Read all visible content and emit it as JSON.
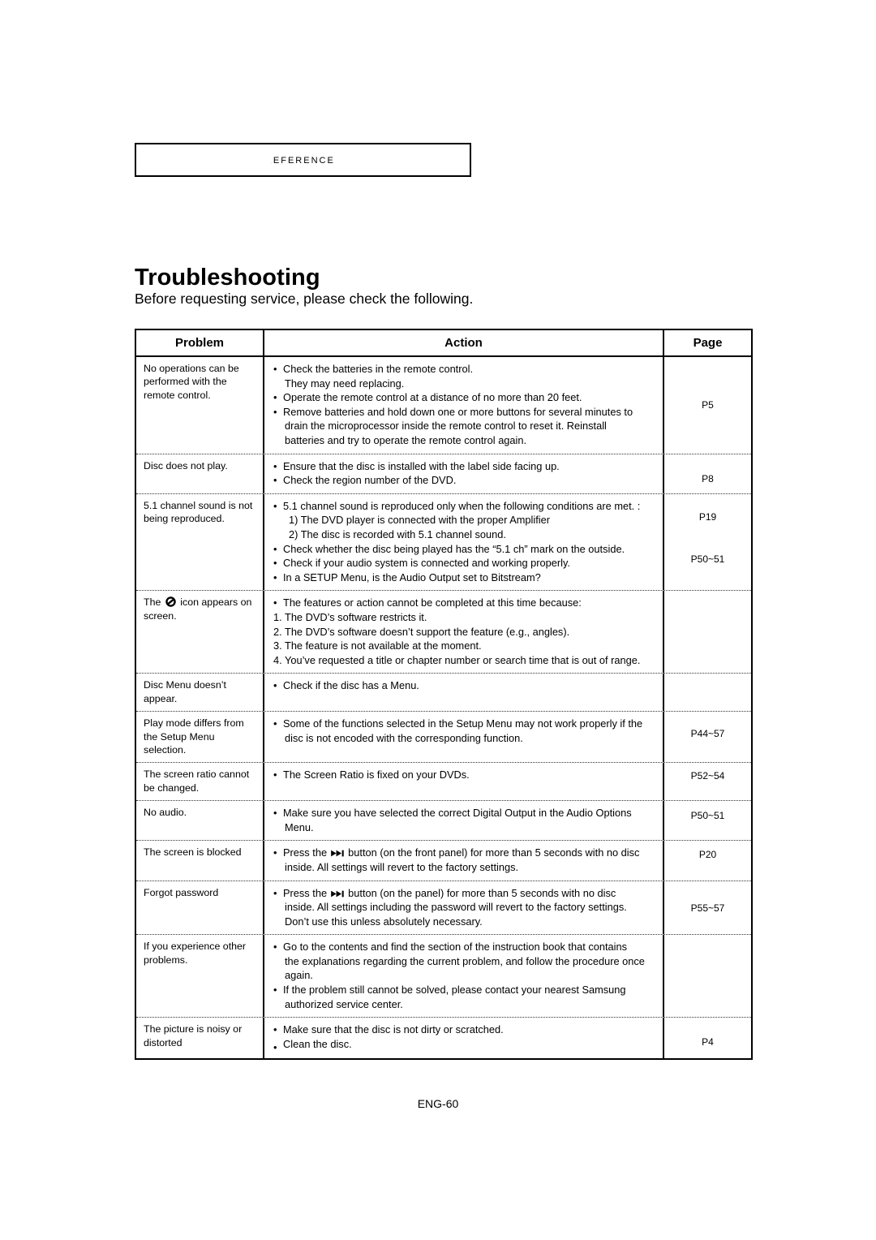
{
  "banner": {
    "label": "REFERENCE"
  },
  "title": "Troubleshooting",
  "subtitle": "Before requesting service, please check the following.",
  "table": {
    "headers": {
      "problem": "Problem",
      "action": "Action",
      "page": "Page"
    },
    "rows": [
      {
        "problem": "No operations can be performed with the remote control.",
        "page": "P5",
        "lines": [
          {
            "type": "bullet",
            "text": "Check the batteries in the remote control."
          },
          {
            "type": "cont",
            "text": "They may need replacing."
          },
          {
            "type": "bullet",
            "text": "Operate the remote control at a distance of no more than 20 feet."
          },
          {
            "type": "bullet",
            "text": "Remove batteries and hold down one or more buttons for several minutes to"
          },
          {
            "type": "cont",
            "text": "drain the microprocessor inside the remote control to reset it. Reinstall"
          },
          {
            "type": "cont",
            "text": "batteries and try to operate the remote control again."
          }
        ]
      },
      {
        "problem": "Disc does not play.",
        "page": "P8",
        "lines": [
          {
            "type": "bullet",
            "text": "Ensure that the disc is installed with the label side facing up."
          },
          {
            "type": "bullet",
            "text": "Check the region number of the DVD."
          }
        ]
      },
      {
        "problem": "5.1 channel sound is not being reproduced.",
        "page": "P19",
        "page2": "P50~51",
        "lines": [
          {
            "type": "bullet",
            "text": "5.1 channel sound is reproduced only when the following conditions are met. :"
          },
          {
            "type": "sub",
            "text": "1) The DVD player is connected with the proper Amplifier"
          },
          {
            "type": "sub",
            "text": "2) The disc is recorded with 5.1 channel sound."
          },
          {
            "type": "bullet",
            "text": "Check whether the disc being played has the “5.1 ch” mark on the outside."
          },
          {
            "type": "bullet",
            "text": "Check if your audio system is connected and working properly."
          },
          {
            "type": "bullet",
            "text": "In a SETUP Menu, is the Audio Output set to Bitstream?"
          }
        ]
      },
      {
        "problem_pre": "The",
        "problem_icon": "prohibition-icon",
        "problem_post": "icon appears on screen.",
        "page": "",
        "lines": [
          {
            "type": "bullet",
            "text": "The features or action cannot be completed at this time because:"
          },
          {
            "type": "num",
            "text": "1. The DVD’s software restricts it."
          },
          {
            "type": "num",
            "text": "2. The DVD’s software doesn’t support the feature (e.g., angles)."
          },
          {
            "type": "num",
            "text": "3. The feature is not available at the moment."
          },
          {
            "type": "num",
            "text": "4. You’ve requested a title or chapter number or search time that is out of range."
          }
        ]
      },
      {
        "problem": "Disc Menu doesn’t appear.",
        "page": "",
        "lines": [
          {
            "type": "bullet",
            "text": "Check if the disc has a Menu."
          }
        ]
      },
      {
        "problem": "Play mode differs from the Setup Menu selection.",
        "page": "P44~57",
        "lines": [
          {
            "type": "bullet",
            "text": "Some of the functions selected in the Setup Menu may not work properly if the"
          },
          {
            "type": "cont",
            "text": "disc is not encoded with the corresponding function."
          }
        ]
      },
      {
        "problem": "The screen ratio cannot be changed.",
        "page": "P52~54",
        "lines": [
          {
            "type": "bullet",
            "text": "The Screen Ratio is fixed on your DVDs."
          }
        ]
      },
      {
        "problem": "No audio.",
        "page": "P50~51",
        "lines": [
          {
            "type": "bullet",
            "text": "Make sure you have selected the correct Digital Output in the Audio Options"
          },
          {
            "type": "cont",
            "text": "Menu."
          }
        ]
      },
      {
        "problem": "The screen is blocked",
        "page": "P20",
        "lines": [
          {
            "type": "bullet-icon",
            "pre": "Press the",
            "icon": "skip-forward-icon",
            "post": "button (on the front panel) for more than 5 seconds with no disc"
          },
          {
            "type": "cont",
            "text": "inside. All settings  will revert to the factory settings."
          }
        ]
      },
      {
        "problem": "Forgot password",
        "page": "P55~57",
        "lines": [
          {
            "type": "bullet-icon",
            "pre": "Press the",
            "icon": "skip-forward-icon",
            "post": "button (on the panel) for more than 5 seconds with no disc"
          },
          {
            "type": "cont",
            "text": "inside. All settings including the password  will revert to the factory settings."
          },
          {
            "type": "cont",
            "text": "Don’t use this unless absolutely necessary."
          }
        ]
      },
      {
        "problem": "If you experience other problems.",
        "page": "",
        "lines": [
          {
            "type": "bullet",
            "text": "Go to the contents and find the section of the instruction book that contains"
          },
          {
            "type": "cont",
            "text": "the explanations regarding the current problem, and follow the procedure once"
          },
          {
            "type": "cont",
            "text": "again."
          },
          {
            "type": "bullet",
            "text": "If the problem still cannot be solved, please contact your nearest Samsung"
          },
          {
            "type": "cont",
            "text": "authorized service center."
          }
        ]
      },
      {
        "problem": "The picture is noisy or distorted",
        "page": "P4",
        "lines": [
          {
            "type": "bullet",
            "text": "Make sure that the disc is not dirty or scratched."
          },
          {
            "type": "bullet-low",
            "text": "Clean the disc."
          }
        ]
      }
    ]
  },
  "footer": {
    "page_label": "ENG-60"
  },
  "colors": {
    "ink": "#000000",
    "paper": "#ffffff"
  }
}
